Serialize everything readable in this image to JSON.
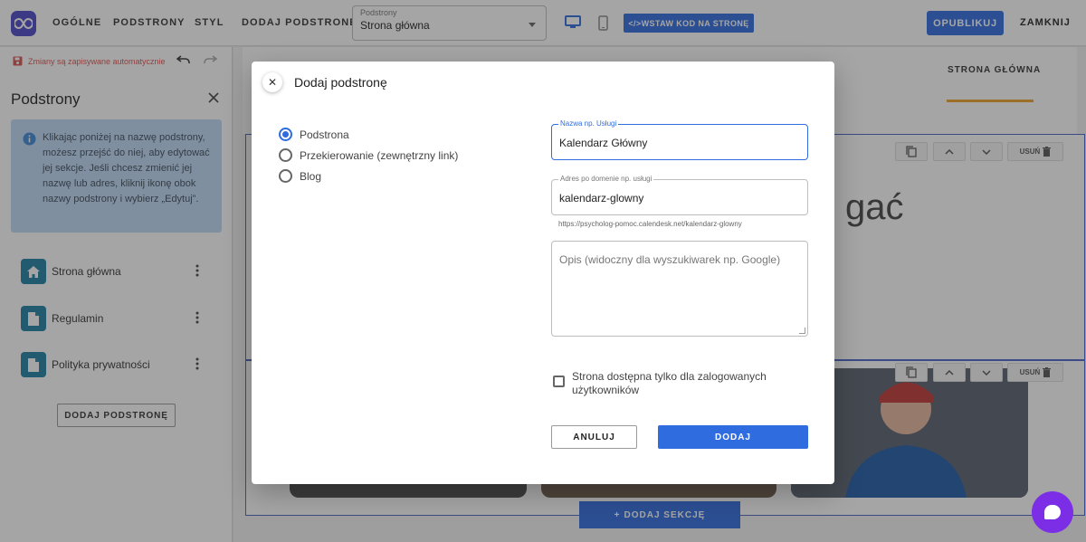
{
  "topbar": {
    "nav": [
      "OGÓLNE",
      "PODSTRONY",
      "STYL",
      "DODAJ PODSTRONĘ"
    ],
    "page_select": {
      "label": "Podstrony",
      "value": "Strona główna"
    },
    "embed_label": "WSTAW KOD NA STRONĘ",
    "publish_label": "OPUBLIKUJ",
    "close_label": "ZAMKNIJ"
  },
  "sidebar": {
    "autosave_text": "Zmiany są zapisywane automatycznie",
    "title": "Podstrony",
    "info": "Klikając poniżej na nazwę podstrony, możesz przejść do niej, aby edytować jej sekcje. Jeśli chcesz zmienić jej nazwę lub adres, kliknij ikonę obok nazwy podstrony i wybierz „Edytuj”.",
    "pages": [
      {
        "label": "Strona główna",
        "icon": "home-icon"
      },
      {
        "label": "Regulamin",
        "icon": "document-icon"
      },
      {
        "label": "Polityka prywatności",
        "icon": "document-icon"
      }
    ],
    "add_button": "DODAJ PODSTRONĘ"
  },
  "canvas": {
    "nav_item": "STRONA GŁÓWNA",
    "hero_fragment": "gać",
    "section_tools": {
      "delete_label": "USUŃ"
    },
    "add_section_label": "DODAJ SEKCJĘ"
  },
  "dialog": {
    "title": "Dodaj podstronę",
    "types": [
      {
        "label": "Podstrona",
        "checked": true
      },
      {
        "label": "Przekierowanie (zewnętrzny link)",
        "checked": false
      },
      {
        "label": "Blog",
        "checked": false
      }
    ],
    "name_field": {
      "label": "Nazwa np. Usługi",
      "value": "Kalendarz Główny"
    },
    "address_field": {
      "label": "Adres po domenie np. usługi",
      "value": "kalendarz-glowny"
    },
    "url_preview": "https://psycholog-pomoc.calendesk.net/kalendarz-glowny",
    "description_placeholder": "Opis (widoczny dla wyszukiwarek np. Google)",
    "logged_in_only": {
      "label": "Strona dostępna tylko dla zalogowanych użytkowników",
      "checked": false
    },
    "cancel_label": "ANULUJ",
    "submit_label": "DODAJ"
  },
  "colors": {
    "primary": "#2f6ce0",
    "logo": "#4b45c9",
    "page_icon": "#1e7ea3",
    "info_bg": "#bfdaf6",
    "chat": "#7b2ee6",
    "autosave": "#d9534f"
  }
}
